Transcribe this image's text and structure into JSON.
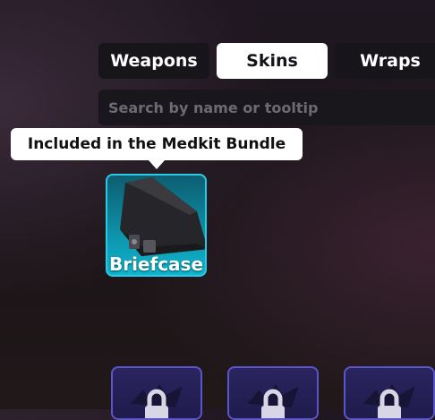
{
  "tabs": [
    {
      "label": "Weapons",
      "active": false
    },
    {
      "label": "Skins",
      "active": true
    },
    {
      "label": "Wraps",
      "active": false
    }
  ],
  "search": {
    "placeholder": "Search by name or tooltip",
    "value": ""
  },
  "tooltip": {
    "text": "Included in the Medkit Bundle"
  },
  "item": {
    "name": "Briefcase",
    "icon": "briefcase-icon",
    "rarity_color": "#2bc9e6"
  },
  "locked_items": [
    {
      "icon": "lock-icon"
    },
    {
      "icon": "lock-icon"
    },
    {
      "icon": "lock-icon"
    }
  ],
  "colors": {
    "active_tab": "#ffffff",
    "inactive_tab": "#17141a",
    "locked_border": "#5c54c9"
  }
}
